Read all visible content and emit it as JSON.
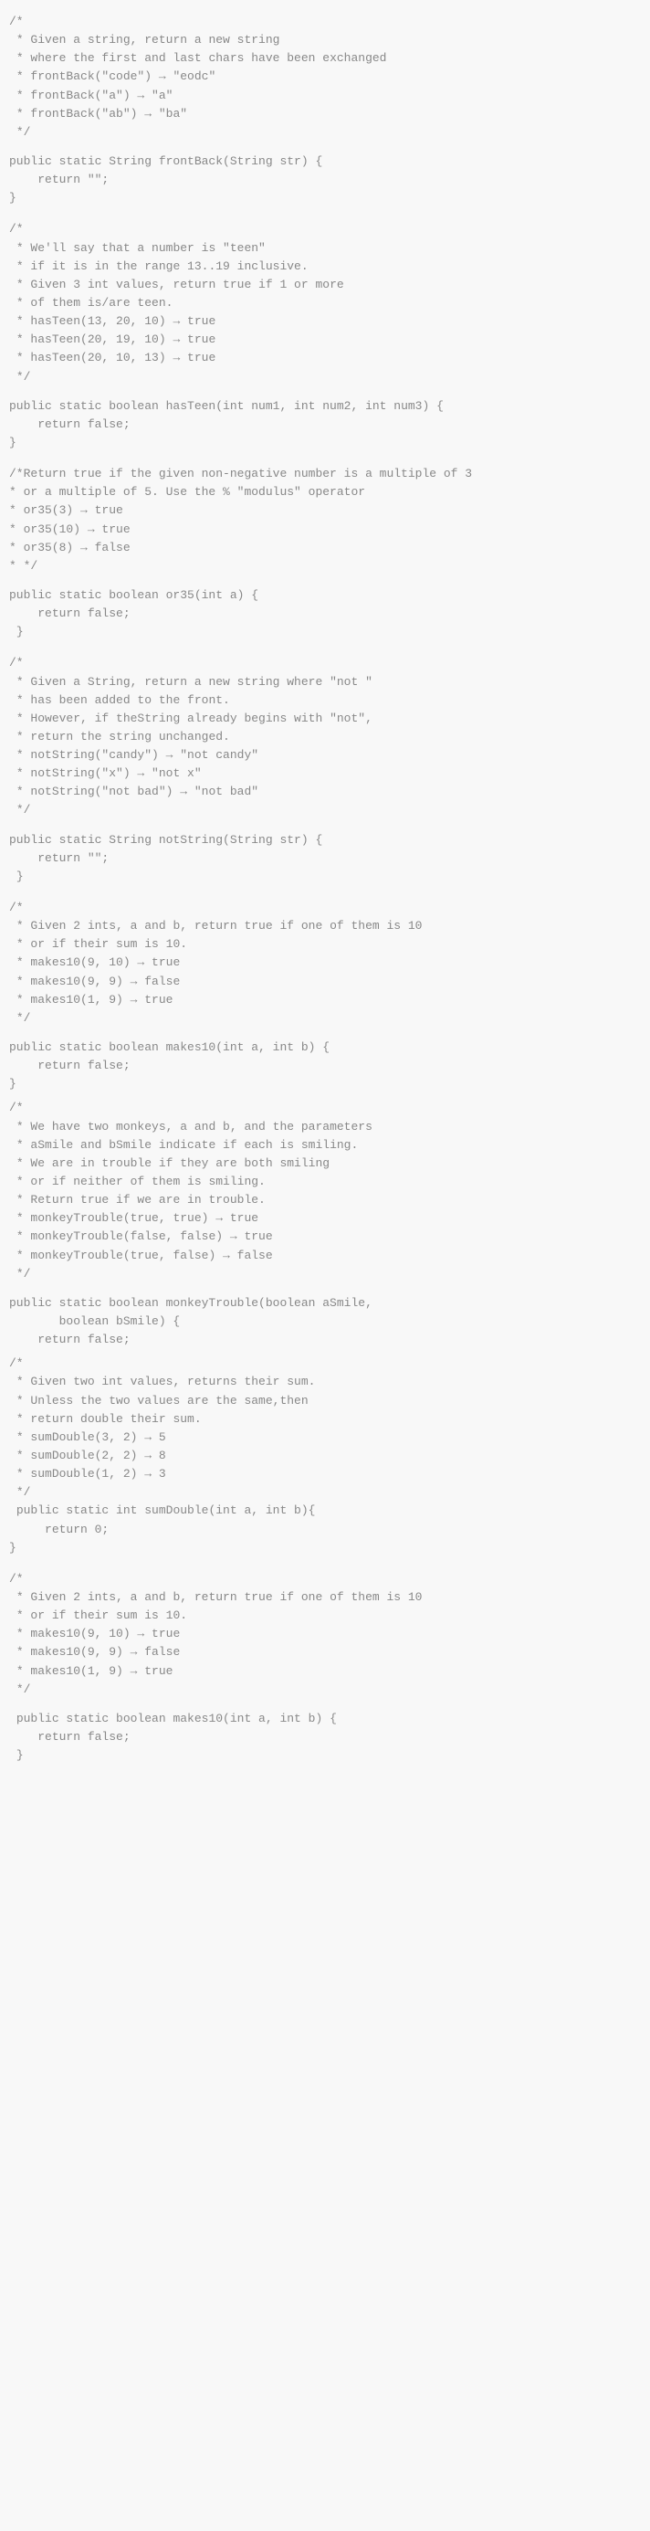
{
  "blocks": [
    {
      "id": "frontBack",
      "comment": "/*\n * Given a string, return a new string\n * where the first and last chars have been exchanged\n * frontBack(\"code\") → \"eodc\"\n * frontBack(\"a\") → \"a\"\n * frontBack(\"ab\") → \"ba\"\n */",
      "code": "public static String frontBack(String str) {\n    return \"\";\n}"
    },
    {
      "id": "hasTeen",
      "comment": "/*\n * We'll say that a number is \"teen\"\n * if it is in the range 13..19 inclusive.\n * Given 3 int values, return true if 1 or more\n * of them is/are teen.\n * hasTeen(13, 20, 10) → true\n * hasTeen(20, 19, 10) → true\n * hasTeen(20, 10, 13) → true\n */",
      "code": "public static boolean hasTeen(int num1, int num2, int num3) {\n    return false;\n}"
    },
    {
      "id": "or35",
      "comment": "/*Return true if the given non-negative number is a multiple of 3\n* or a multiple of 5. Use the % \"modulus\" operator\n* or35(3) → true\n* or35(10) → true\n* or35(8) → false\n* */",
      "code": "public static boolean or35(int a) {\n    return false;\n }"
    },
    {
      "id": "notString",
      "comment": "/*\n * Given a String, return a new string where \"not \"\n * has been added to the front.\n * However, if theString already begins with \"not\",\n * return the string unchanged.\n * notString(\"candy\") → \"not candy\"\n * notString(\"x\") → \"not x\"\n * notString(\"not bad\") → \"not bad\"\n */",
      "code": "public static String notString(String str) {\n    return \"\";\n }"
    },
    {
      "id": "makes10_first",
      "comment": "/*\n * Given 2 ints, a and b, return true if one of them is 10\n * or if their sum is 10.\n * makes10(9, 10) → true\n * makes10(9, 9) → false\n * makes10(1, 9) → true\n */",
      "code": "public static boolean makes10(int a, int b) {\n    return false;\n}"
    },
    {
      "id": "monkeyTrouble",
      "comment": "/*\n * We have two monkeys, a and b, and the parameters\n * aSmile and bSmile indicate if each is smiling.\n * We are in trouble if they are both smiling\n * or if neither of them is smiling.\n * Return true if we are in trouble.\n * monkeyTrouble(true, true) → true\n * monkeyTrouble(false, false) → true\n * monkeyTrouble(true, false) → false\n */",
      "code": "public static boolean monkeyTrouble(boolean aSmile,\n       boolean bSmile) {\n    return false;"
    },
    {
      "id": "sumDouble",
      "comment": "/*\n * Given two int values, returns their sum.\n * Unless the two values are the same,then\n * return double their sum.\n * sumDouble(3, 2) → 5\n * sumDouble(2, 2) → 8\n * sumDouble(1, 2) → 3\n */",
      "code": " public static int sumDouble(int a, int b){\n     return 0;\n}"
    },
    {
      "id": "makes10_second",
      "comment": "/*\n * Given 2 ints, a and b, return true if one of them is 10\n * or if their sum is 10.\n * makes10(9, 10) → true\n * makes10(9, 9) → false\n * makes10(1, 9) → true\n */",
      "code": " public static boolean makes10(int a, int b) {\n    return false;\n }"
    }
  ]
}
